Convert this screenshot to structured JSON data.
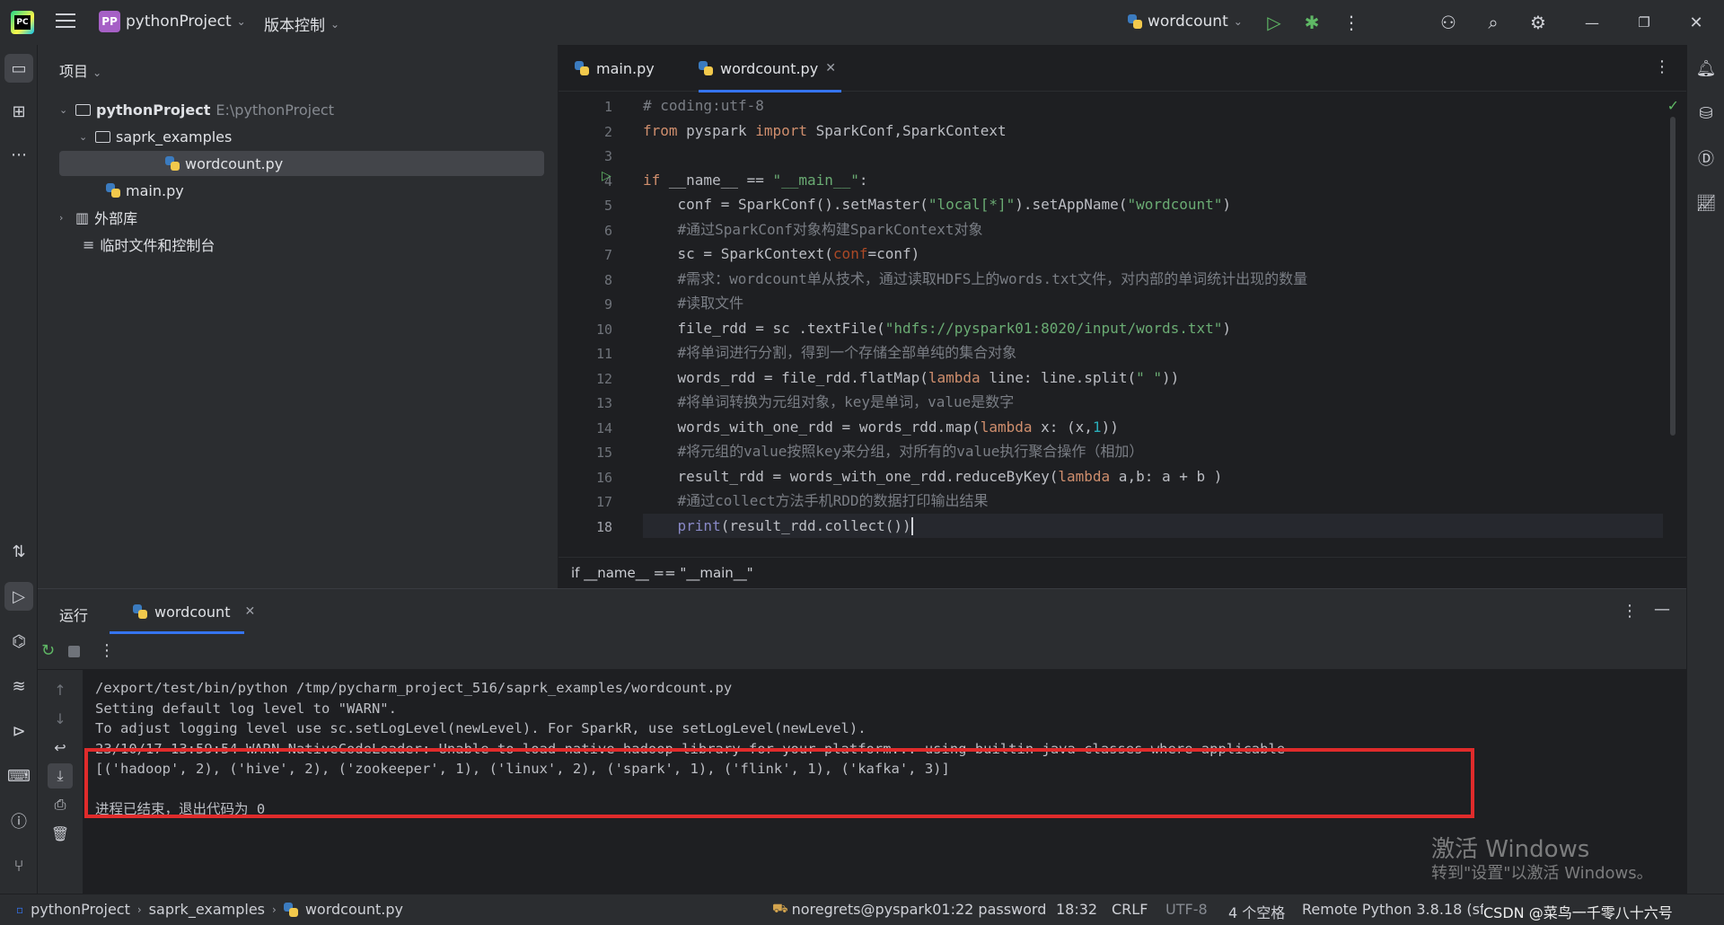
{
  "titlebar": {
    "project_badge": "PP",
    "project_name": "pythonProject",
    "vcs_menu": "版本控制",
    "run_config": "wordcount"
  },
  "project_panel": {
    "title": "项目",
    "tree": [
      {
        "label": "pythonProject",
        "extra": "E:\\pythonProject"
      },
      {
        "label": "saprk_examples"
      },
      {
        "label": "wordcount.py"
      },
      {
        "label": "main.py"
      },
      {
        "label": "外部库"
      },
      {
        "label": "临时文件和控制台"
      }
    ]
  },
  "editor": {
    "tabs": [
      {
        "label": "main.py"
      },
      {
        "label": "wordcount.py"
      }
    ],
    "line_numbers": [
      "1",
      "2",
      "3",
      "4",
      "5",
      "6",
      "7",
      "8",
      "9",
      "10",
      "11",
      "12",
      "13",
      "14",
      "15",
      "16",
      "17",
      "18"
    ],
    "code_lines": [
      "# coding:utf-8",
      "from pyspark import SparkConf,SparkContext",
      "",
      "if __name__ == \"__main__\":",
      "    conf = SparkConf().setMaster(\"local[*]\").setAppName(\"wordcount\")",
      "    #通过SparkConf对象构建SparkContext对象",
      "    sc = SparkContext(conf=conf)",
      "    #需求：wordcount单从技术，通过读取HDFS上的words.txt文件，对内部的单词统计出现的数量",
      "    #读取文件",
      "    file_rdd = sc .textFile(\"hdfs://pyspark01:8020/input/words.txt\")",
      "    #将单词进行分割，得到一个存储全部单纯的集合对象",
      "    words_rdd = file_rdd.flatMap(lambda line: line.split(\" \"))",
      "    #将单词转换为元组对象，key是单词，value是数字",
      "    words_with_one_rdd = words_rdd.map(lambda x: (x,1))",
      "    #将元组的value按照key来分组，对所有的value执行聚合操作（相加）",
      "    result_rdd = words_with_one_rdd.reduceByKey(lambda a,b: a + b )",
      "    #通过collect方法手机RDD的数据打印输出结果",
      "    print(result_rdd.collect())"
    ],
    "breadcrumb": "if __name__ == \"__main__\""
  },
  "run_panel": {
    "title": "运行",
    "tab_label": "wordcount",
    "console_lines": [
      "/export/test/bin/python /tmp/pycharm_project_516/saprk_examples/wordcount.py",
      "Setting default log level to \"WARN\".",
      "To adjust logging level use sc.setLogLevel(newLevel). For SparkR, use setLogLevel(newLevel).",
      "23/10/17 13:59:54 WARN NativeCodeLoader: Unable to load native-hadoop library for your platform... using builtin-java classes where applicable",
      "[('hadoop', 2), ('hive', 2), ('zookeeper', 1), ('linux', 2), ('spark', 1), ('flink', 1), ('kafka', 3)]",
      "",
      "进程已结束，退出代码为 0"
    ]
  },
  "statusbar": {
    "crumbs": [
      "pythonProject",
      "saprk_examples",
      "wordcount.py"
    ],
    "remote": "noregrets@pyspark01:22 password",
    "position": "18:32",
    "line_sep": "CRLF",
    "encoding": "UTF-8",
    "indent": "4 个空格",
    "interpreter": "Remote Python 3.8.18 (sf..."
  },
  "watermark": {
    "line1": "激活 Windows",
    "line2": "转到\"设置\"以激活 Windows。",
    "csdn": "CSDN @菜鸟一千零八十六号"
  },
  "colors": {
    "accent": "#3574f0",
    "highlight_box": "#e02b2b",
    "run_green": "#5fb865"
  }
}
